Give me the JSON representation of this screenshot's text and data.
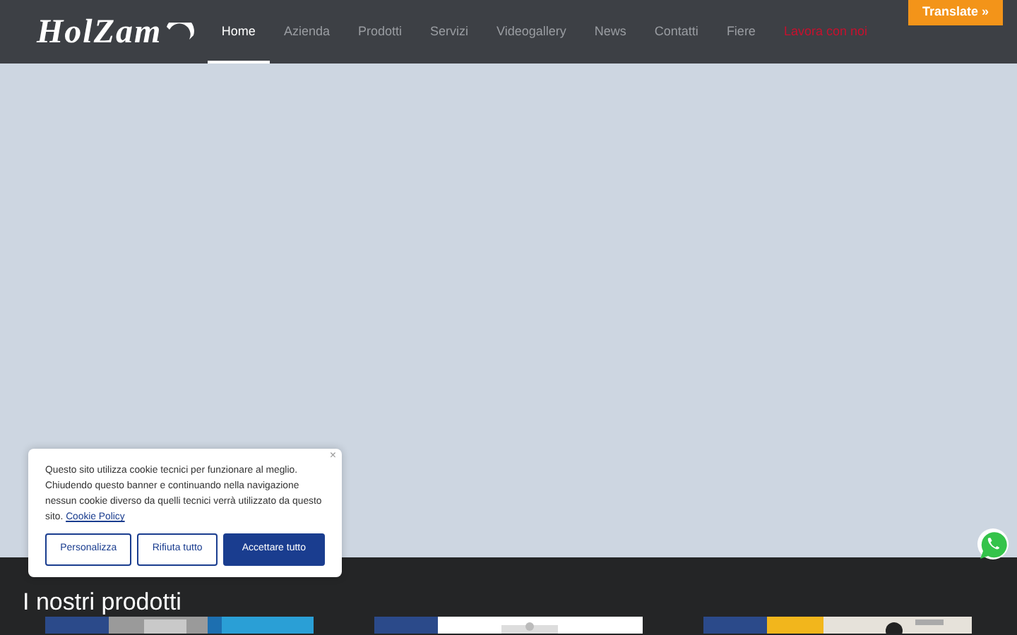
{
  "header": {
    "logo": "HolZam",
    "nav": [
      {
        "label": "Home",
        "selected": true,
        "kind": "link"
      },
      {
        "label": "Azienda",
        "selected": false,
        "kind": "link"
      },
      {
        "label": "Prodotti",
        "selected": false,
        "kind": "link"
      },
      {
        "label": "Servizi",
        "selected": false,
        "kind": "link"
      },
      {
        "label": "Videogallery",
        "selected": false,
        "kind": "link"
      },
      {
        "label": "News",
        "selected": false,
        "kind": "link"
      },
      {
        "label": "Contatti",
        "selected": false,
        "kind": "link"
      },
      {
        "label": "Fiere",
        "selected": false,
        "kind": "link"
      },
      {
        "label": "Lavora con noi",
        "selected": false,
        "kind": "highlight"
      }
    ],
    "translate": "Translate »"
  },
  "cookie_banner": {
    "close": "×",
    "text": "Questo sito utilizza cookie tecnici per funzionare al meglio. Chiudendo questo banner e continuando nella navigazione nessun cookie diverso da quelli tecnici verrà utilizzato da questo sito.",
    "link": "Cookie Policy",
    "buttons": [
      {
        "label": "Personalizza",
        "kind": "outline"
      },
      {
        "label": "Rifiuta tutto",
        "kind": "outline"
      },
      {
        "label": "Accettare tutto",
        "kind": "primary"
      }
    ]
  },
  "products": {
    "title": "I nostri prodotti"
  }
}
